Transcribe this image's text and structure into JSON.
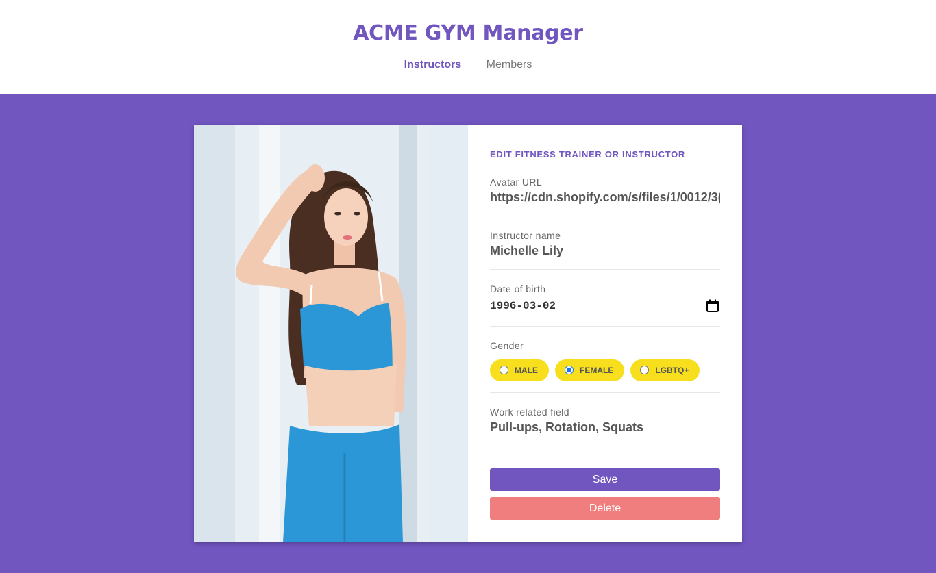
{
  "app": {
    "title": "ACME GYM Manager"
  },
  "nav": {
    "items": [
      {
        "label": "Instructors",
        "active": true
      },
      {
        "label": "Members",
        "active": false
      }
    ]
  },
  "form": {
    "title": "EDIT FITNESS TRAINER OR INSTRUCTOR",
    "avatar": {
      "label": "Avatar URL",
      "value": "https://cdn.shopify.com/s/files/1/0012/3("
    },
    "name": {
      "label": "Instructor name",
      "value": "Michelle Lily"
    },
    "birth": {
      "label": "Date of birth",
      "value": "1996-03-02"
    },
    "gender": {
      "label": "Gender",
      "options": [
        {
          "label": "MALE",
          "checked": false
        },
        {
          "label": "FEMALE",
          "checked": true
        },
        {
          "label": "LGBTQ+",
          "checked": false
        }
      ]
    },
    "work": {
      "label": "Work related field",
      "value": "Pull-ups, Rotation, Squats"
    },
    "save_label": "Save",
    "delete_label": "Delete"
  },
  "colors": {
    "brand": "#7156c0",
    "pill": "#f7df1e",
    "delete": "#f07e7e"
  },
  "icons": {
    "date_picker": "calendar-icon"
  }
}
